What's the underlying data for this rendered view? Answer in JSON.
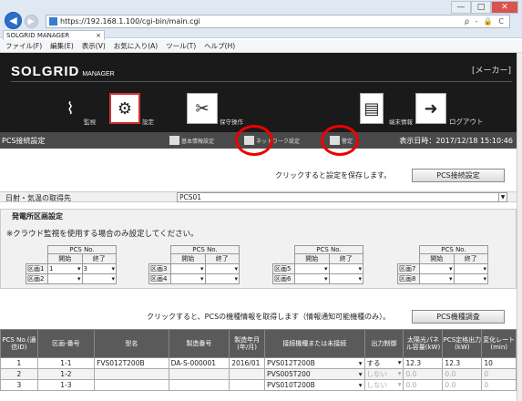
{
  "browser": {
    "url": "https://192.168.1.100/cgi-bin/main.cgi",
    "search_hint": "ρ - 🔒 C",
    "tab_title": "SOLGRID MANAGER",
    "tab_close": "×",
    "window_controls": [
      "—",
      "□",
      "✕"
    ],
    "menu": [
      "ファイル(F)",
      "編集(E)",
      "表示(V)",
      "お気に入り(A)",
      "ツール(T)",
      "ヘルプ(H)"
    ]
  },
  "app": {
    "logo": "SOLGRID",
    "logo_sub": "MANAGER",
    "maker": "[メーカー]",
    "nav": [
      {
        "label": "監視",
        "icon": "broom-icon"
      },
      {
        "label": "設定",
        "icon": "gear-icon"
      },
      {
        "label": "保守操作",
        "icon": "tools-icon"
      },
      {
        "label": "端末情報",
        "icon": "document-icon"
      },
      {
        "label": "ログアウト",
        "icon": "logout-icon"
      }
    ]
  },
  "bar": {
    "title": "PCS接続設定",
    "buttons": [
      "基本情報設定",
      "ネットワーク設定",
      "警定"
    ],
    "datetime": "表示日時：2017/12/18 15:10:46"
  },
  "save": {
    "hint": "クリックすると設定を保存します。",
    "button": "PCS接続設定"
  },
  "weather": {
    "label": "日射・気温の取得先",
    "value": "PCS01"
  },
  "section": {
    "title": "発電所区画設定",
    "note": "※クラウド監視を使用する場合のみ設定してください。",
    "pcs_no": "PCS No.",
    "start": "開始",
    "end": "終了",
    "groups": [
      {
        "rows": [
          {
            "name": "区画1",
            "start": "1",
            "end": "3"
          },
          {
            "name": "区画2",
            "start": "",
            "end": ""
          }
        ]
      },
      {
        "rows": [
          {
            "name": "区画3",
            "start": "",
            "end": ""
          },
          {
            "name": "区画4",
            "start": "",
            "end": ""
          }
        ]
      },
      {
        "rows": [
          {
            "name": "区画5",
            "start": "",
            "end": ""
          },
          {
            "name": "区画6",
            "start": "",
            "end": ""
          }
        ]
      },
      {
        "rows": [
          {
            "name": "区画7",
            "start": "",
            "end": ""
          },
          {
            "name": "区画8",
            "start": "",
            "end": ""
          }
        ]
      }
    ]
  },
  "fetch": {
    "hint": "クリックすると、PCSの機種情報を取得します（情報通知可能機種のみ）。",
    "button": "PCS機種調査"
  },
  "table": {
    "headers": [
      "PCS No.(通信ID)",
      "区画-番号",
      "型名",
      "製造番号",
      "製造年月(年/月)",
      "接続機種または未接続",
      "出力制御",
      "太陽光パネル容量(kW)",
      "PCS定格出力(kW)",
      "変化レート(min)"
    ],
    "rows": [
      [
        "1",
        "1-1",
        "FVS012T200B",
        "DA-S-000001",
        "2016/01",
        "PVS012T200B",
        "する",
        "12.3",
        "12.3",
        "10"
      ],
      [
        "2",
        "1-2",
        "",
        "",
        "",
        "PVS005T200",
        "しない",
        "0.0",
        "0.0",
        "0"
      ],
      [
        "3",
        "1-3",
        "",
        "",
        "",
        "PVS010T200B",
        "しない",
        "0.0",
        "0.0",
        "0"
      ]
    ]
  }
}
